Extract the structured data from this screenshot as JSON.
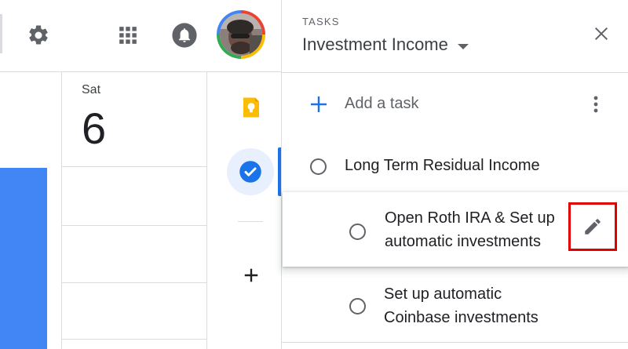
{
  "calendar": {
    "day_name": "Sat",
    "day_number": "6"
  },
  "tasks_panel": {
    "header_label": "TASKS",
    "list_title": "Investment Income",
    "add_task_label": "Add a task",
    "tasks": [
      {
        "title": "Long Term Residual Income",
        "indent": 0
      },
      {
        "title": "Open Roth IRA & Set up automatic investments",
        "indent": 1
      },
      {
        "title": "Set up automatic Coinbase investments",
        "indent": 1
      }
    ]
  },
  "colors": {
    "accent_blue": "#1a73e8",
    "event_blue": "#4285f4",
    "highlight_red": "#e00000",
    "keep_yellow": "#fbbc04"
  },
  "icons": {
    "settings": "gear-icon",
    "apps": "apps-grid-icon",
    "notifications": "bell-icon",
    "keep": "keep-bulb-icon",
    "tasks": "tasks-check-icon",
    "add": "plus-icon",
    "close": "close-icon",
    "more": "more-vert-icon",
    "edit": "pencil-icon"
  }
}
